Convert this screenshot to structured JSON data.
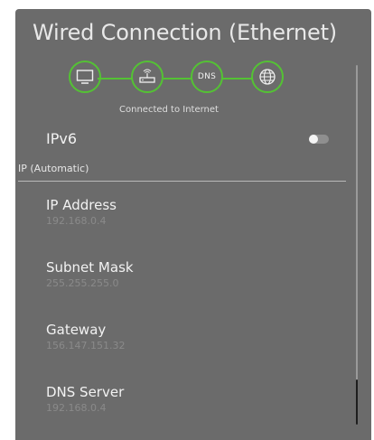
{
  "window": {
    "title": "Wired Connection (Ethernet)"
  },
  "status": {
    "nodes": [
      {
        "icon": "monitor-icon"
      },
      {
        "icon": "router-icon"
      },
      {
        "label": "DNS"
      },
      {
        "icon": "globe-icon"
      }
    ],
    "text": "Connected to Internet",
    "accent_color": "#54c234"
  },
  "ipv6": {
    "label": "IPv6",
    "enabled": false
  },
  "ip_section": {
    "header": "IP (Automatic)",
    "items": [
      {
        "label": "IP Address",
        "value": "192.168.0.4"
      },
      {
        "label": "Subnet Mask",
        "value": "255.255.255.0"
      },
      {
        "label": "Gateway",
        "value": "156.147.151.32"
      },
      {
        "label": "DNS Server",
        "value": "192.168.0.4"
      }
    ]
  }
}
